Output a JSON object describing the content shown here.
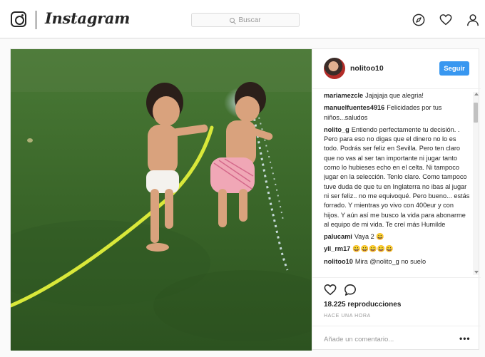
{
  "nav": {
    "brand": "Instagram",
    "search_placeholder": "Buscar",
    "icons": [
      "explore-icon",
      "heart-icon",
      "profile-icon"
    ]
  },
  "post": {
    "author": "nolitoo10",
    "follow_label": "Seguir",
    "comments": [
      {
        "user": "mariamezcle",
        "text": "Jajajaja que alegria!"
      },
      {
        "user": "manuelfuentes4916",
        "text": "Felicidades por tus niños...saludos"
      },
      {
        "user": "nolito_g",
        "text": "Entiendo perfectamente tu decisión. . Pero para eso no digas que el dinero no lo es todo. Podrás ser feliz en Sevilla. Pero ten claro que no vas al ser tan importante ni jugar tanto como lo hubieses echo en el celta. Ni tampoco jugar en la selección. Tenlo claro. Como tampoco tuve duda de que tu en Inglaterra no ibas al jugar ni ser feliz.. no me equivoqué. Pero bueno... estás forrado. Y mientras yo vivo con 400eur y con hijos. Y aún así me busco la vida para abonarme al equipo de mi vida. Te creí más Humilde"
      },
      {
        "user": "palucami",
        "text": "Vaya 2 😀"
      },
      {
        "user": "yll_rm17",
        "text": "😀😀😀😀😀"
      },
      {
        "user": "nolitoo10",
        "text": "Mira @nolito_g no suelo"
      }
    ],
    "views": "18.225 reproducciones",
    "time_ago": "HACE UNA HORA",
    "comment_placeholder": "Añade un comentario...",
    "more_label": "•••"
  },
  "colors": {
    "accent": "#3897f0",
    "border": "#dbdbdb",
    "grass": "#3d6b2d"
  }
}
